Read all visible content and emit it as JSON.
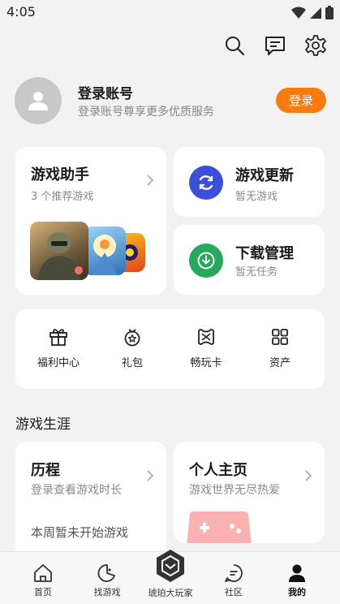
{
  "status": {
    "time": "4:05"
  },
  "profile": {
    "title": "登录账号",
    "subtitle": "登录账号尊享更多优质服务",
    "login_label": "登录"
  },
  "assistant": {
    "title": "游戏助手",
    "subtitle": "3 个推荐游戏"
  },
  "update": {
    "title": "游戏更新",
    "subtitle": "暂无游戏"
  },
  "download": {
    "title": "下载管理",
    "subtitle": "暂无任务"
  },
  "features": [
    {
      "label": "福利中心",
      "icon": "gift-icon"
    },
    {
      "label": "礼包",
      "icon": "giftbag-icon"
    },
    {
      "label": "畅玩卡",
      "icon": "card-icon"
    },
    {
      "label": "资产",
      "icon": "grid-icon"
    }
  ],
  "career": {
    "section_title": "游戏生涯"
  },
  "history": {
    "title": "历程",
    "subtitle": "登录查看游戏时长",
    "note": "本周暂未开始游戏"
  },
  "homepage": {
    "title": "个人主页",
    "subtitle": "游戏世界无尽热爱"
  },
  "nav": [
    {
      "label": "首页",
      "icon": "home-icon"
    },
    {
      "label": "找游戏",
      "icon": "discover-icon"
    },
    {
      "label": "琥珀大玩家",
      "icon": "amber-logo-icon"
    },
    {
      "label": "社区",
      "icon": "community-icon"
    },
    {
      "label": "我的",
      "icon": "profile-icon"
    }
  ],
  "colors": {
    "accent": "#f77b12",
    "update_icon_bg": "#3d4fd9",
    "download_icon_bg": "#27a85a",
    "background": "#f2f2f2"
  }
}
